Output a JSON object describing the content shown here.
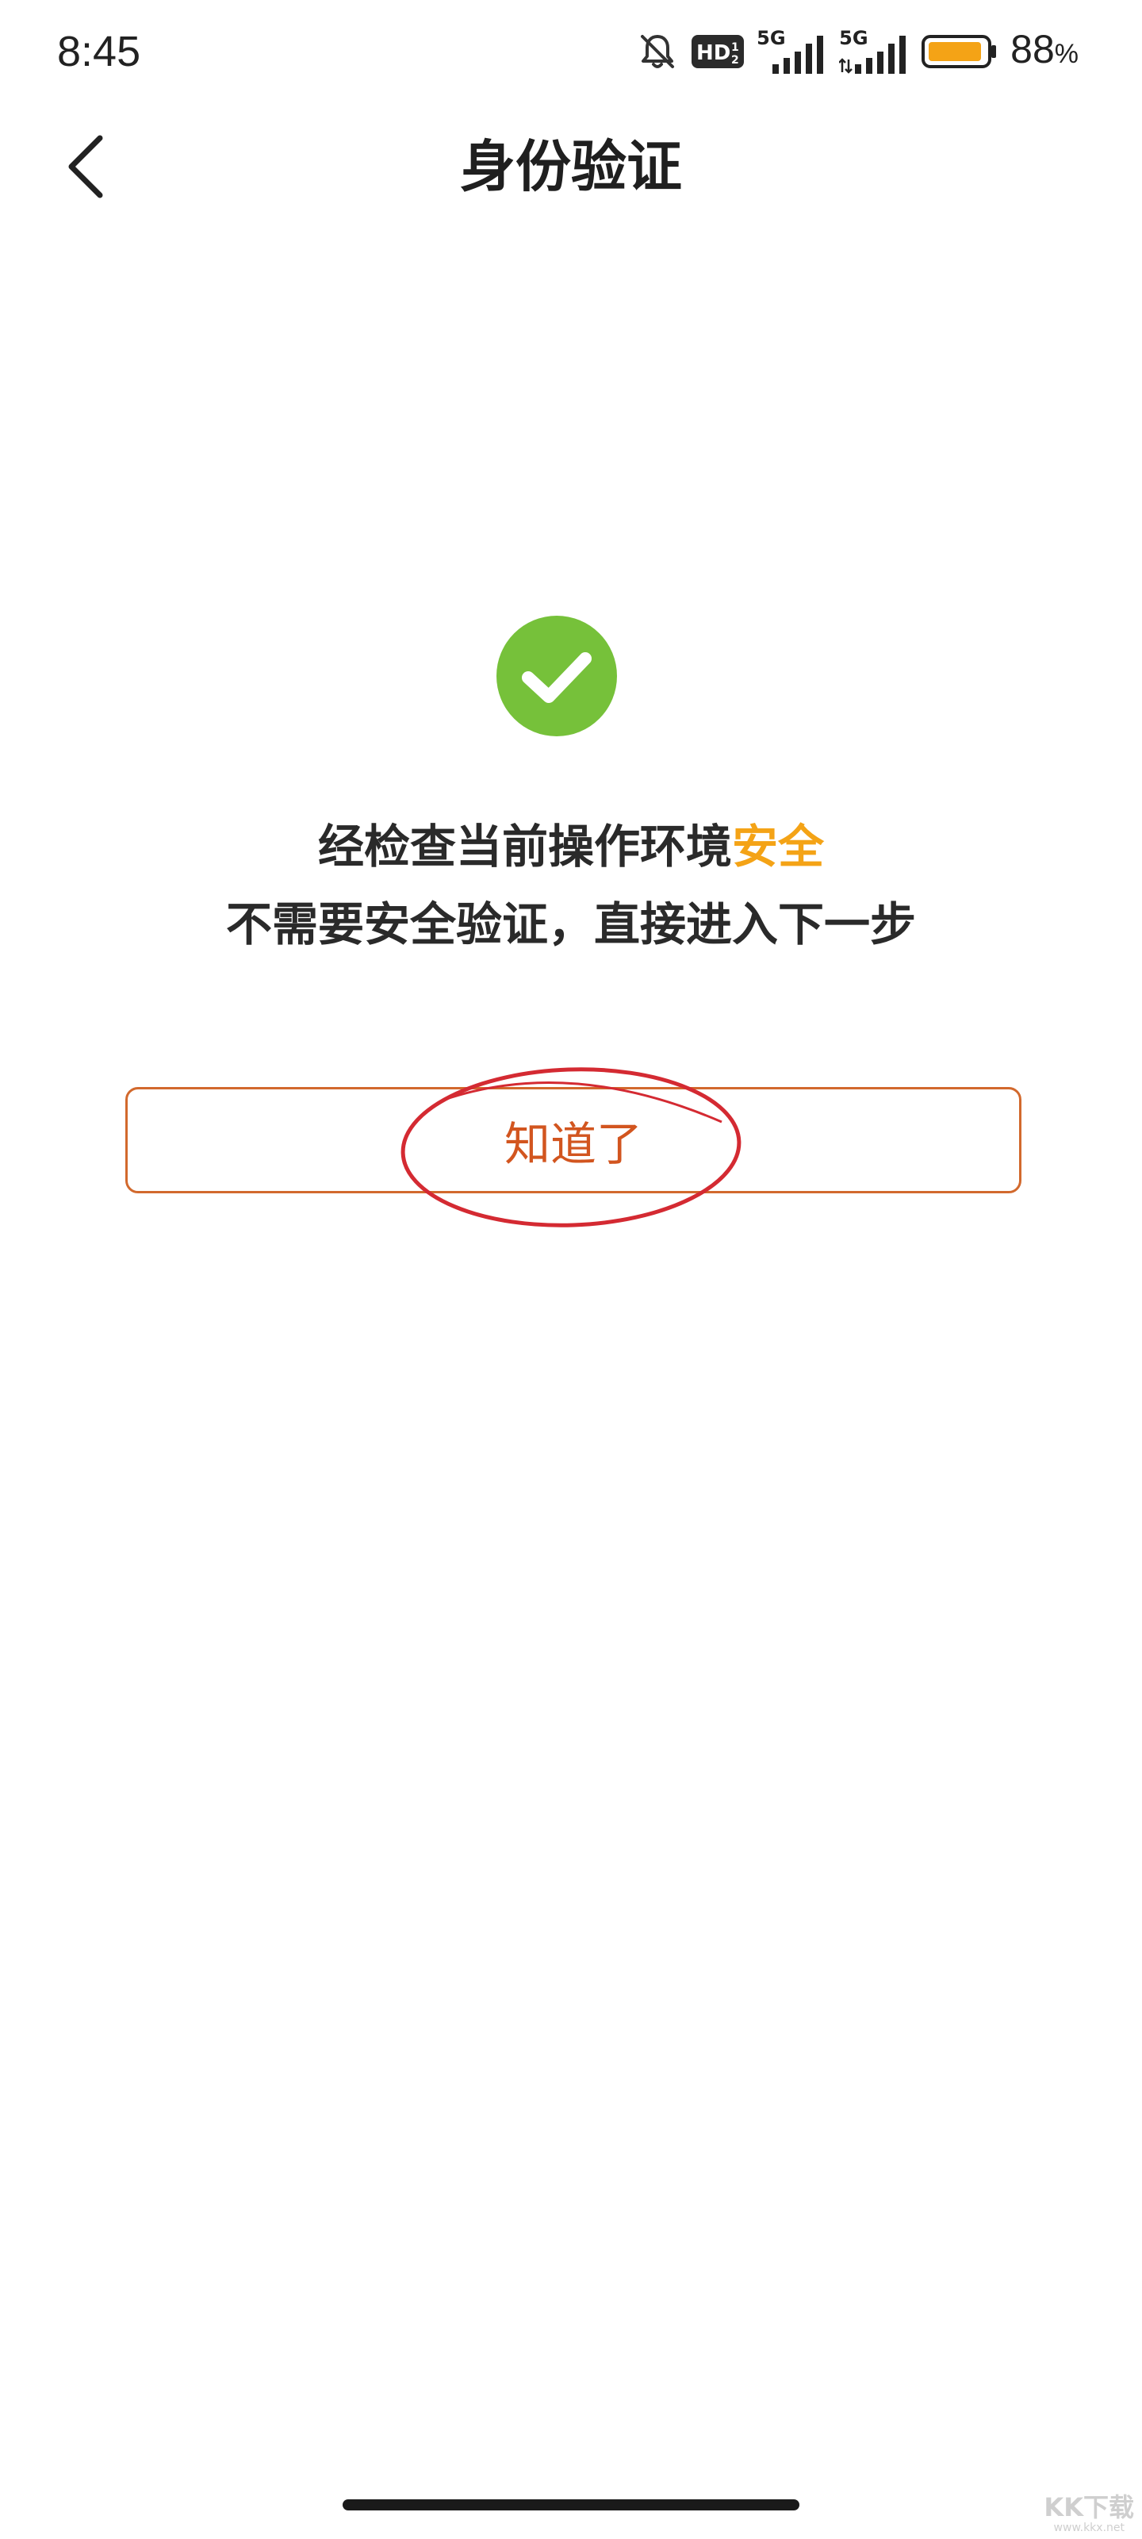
{
  "status_bar": {
    "time": "8:45",
    "hd_label": "HD",
    "network_1": "5G",
    "network_2": "5G",
    "battery_percent": "88",
    "battery_unit": "%"
  },
  "header": {
    "title": "身份验证"
  },
  "message": {
    "line1_prefix": "经检查当前操作环境",
    "line1_highlight": "安全",
    "line2": "不需要安全验证，直接进入下一步"
  },
  "confirm_button": {
    "label": "知道了"
  },
  "watermark": {
    "main": "KK下载",
    "sub": "www.kkx.net"
  },
  "colors": {
    "success_green": "#76c13a",
    "highlight_orange": "#f4a316",
    "button_border": "#d2692d",
    "button_text": "#d2551f",
    "annotation_red": "#d42a32"
  },
  "icons": {
    "back": "chevron-left-icon",
    "success": "check-circle-icon",
    "bell_muted": "bell-off-icon",
    "signal": "signal-bars-icon",
    "battery": "battery-icon"
  }
}
